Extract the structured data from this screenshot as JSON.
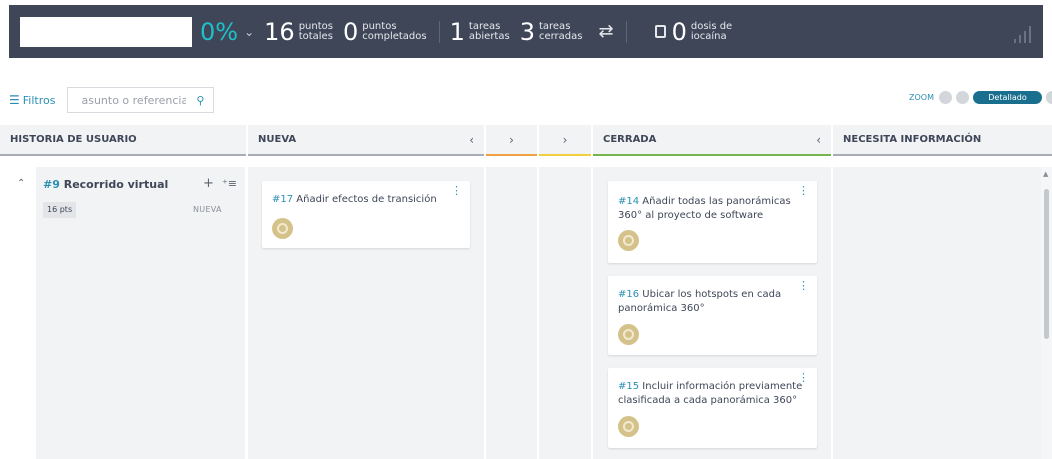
{
  "stats": {
    "percent": "0%",
    "total_points": {
      "value": "16",
      "label_line1": "puntos",
      "label_line2": "totales"
    },
    "done_points": {
      "value": "0",
      "label_line1": "puntos",
      "label_line2": "completados"
    },
    "open_tasks": {
      "value": "1",
      "label_line1": "tareas",
      "label_line2": "abiertas"
    },
    "closed_tasks": {
      "value": "3",
      "label_line1": "tareas",
      "label_line2": "cerradas"
    },
    "iocaine": {
      "value": "0",
      "label_line1": "dosis de",
      "label_line2": "iocaína"
    }
  },
  "filters": {
    "label": "Filtros",
    "search_placeholder": "asunto o referencia"
  },
  "zoom": {
    "label": "ZOOM",
    "selected": "Detallado"
  },
  "columns": {
    "story": "HISTORIA DE USUARIO",
    "nueva": "NUEVA",
    "cerrada": "CERRADA",
    "needs_info": "NECESITA INFORMACIÓN"
  },
  "story": {
    "ref": "#9",
    "title": "Recorrido virtual",
    "points": "16 pts",
    "status": "NUEVA"
  },
  "cards": {
    "c17": {
      "ref": "#17",
      "line1": "Añadir efectos de transición"
    },
    "c14": {
      "ref": "#14",
      "line1": "Añadir todas las panorámicas",
      "line2": "360° al proyecto de software"
    },
    "c16": {
      "ref": "#16",
      "line1": "Ubicar los hotspots en cada",
      "line2": "panorámica 360°"
    },
    "c15": {
      "ref": "#15",
      "line1": "Incluir información previamente",
      "line2": "clasificada a cada panorámica 360°"
    }
  },
  "colors": {
    "topbar": "#3e4658",
    "accent": "#1fc0c9",
    "link": "#2a8fb3",
    "orange": "#f0a142",
    "yellow": "#f2cf3c",
    "green": "#74b54d"
  }
}
